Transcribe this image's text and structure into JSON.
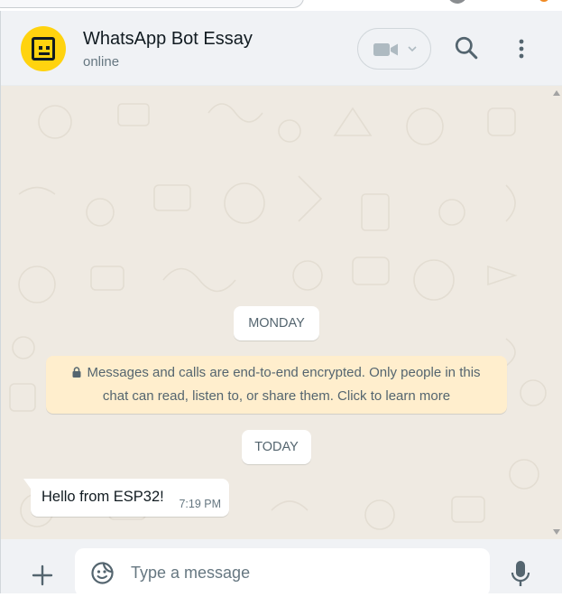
{
  "header": {
    "title": "WhatsApp Bot Essay",
    "status": "online",
    "avatar_icon": "robot-face-icon",
    "avatar_color": "#ffd30f",
    "icons": [
      "video-camera-icon",
      "chevron-down-icon",
      "search-icon",
      "more-vert-icon"
    ]
  },
  "chat": {
    "background_color": "#efeae2",
    "date_separators": [
      "MONDAY",
      "TODAY"
    ],
    "encryption_notice": {
      "icon": "lock-icon",
      "line1": "Messages and calls are end-to-end encrypted. Only people in this",
      "line2": "chat can read, listen to, or share them. Click to learn more",
      "background_color": "#ffeecd"
    },
    "messages": [
      {
        "direction": "incoming",
        "text": "Hello from ESP32!",
        "time": "7:19 PM"
      }
    ]
  },
  "composer": {
    "placeholder": "Type a message",
    "value": "",
    "icons": [
      "plus-icon",
      "sticker-icon",
      "microphone-icon"
    ]
  }
}
